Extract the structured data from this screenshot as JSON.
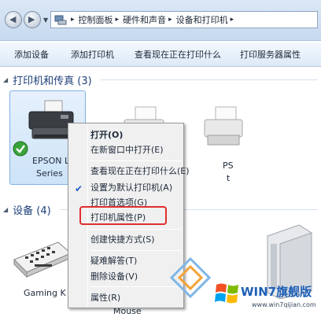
{
  "breadcrumb": {
    "items": [
      "控制面板",
      "硬件和声音",
      "设备和打印机"
    ]
  },
  "toolbar": {
    "items": [
      "添加设备",
      "添加打印机",
      "查看现在正在打印什么",
      "打印服务器属性"
    ]
  },
  "groups": {
    "printers": "打印机和传真 (3)",
    "devices": "设备 (4)"
  },
  "devices": {
    "epson_line1": "EPSON L31",
    "epson_line2": "Series",
    "partial_ps": "PS",
    "partial_t": "t",
    "gaming": "Gaming K",
    "mouse": "Mouse"
  },
  "context_menu": {
    "items": [
      "打开(O)",
      "在新窗口中打开(E)",
      "查看现在正在打印什么(E)",
      "设置为默认打印机(A)",
      "打印首选项(G)",
      "打印机属性(P)",
      "创建快捷方式(S)",
      "疑难解答(T)",
      "删除设备(V)",
      "属性(R)"
    ],
    "checked_item": "设置为默认打印机(A)",
    "highlighted_item": "打印机属性(P)"
  },
  "watermark": {
    "title": "WIN7旗舰版",
    "url": "www.win7qijian.com"
  },
  "colors": {
    "highlight": "#e02d2d",
    "group_title": "#1e3f7a"
  }
}
